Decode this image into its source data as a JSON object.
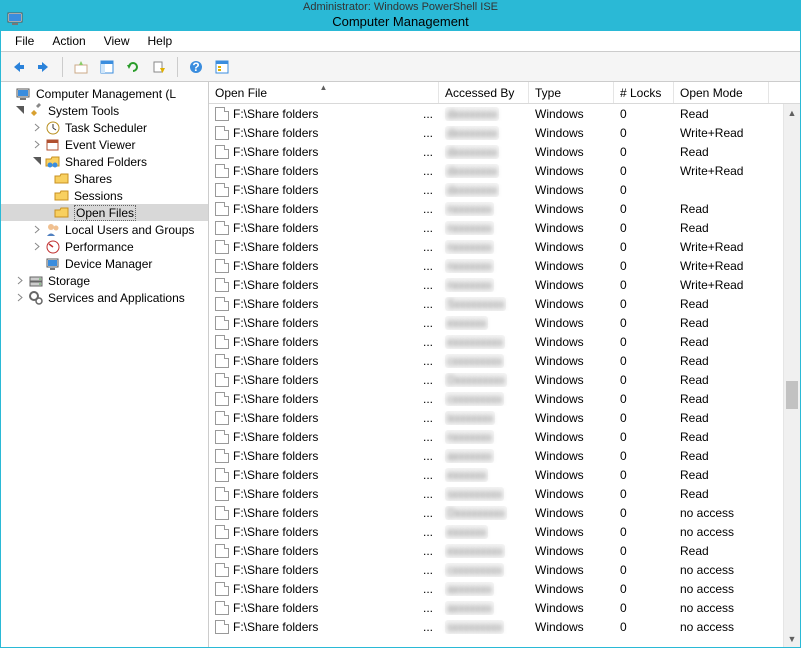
{
  "window": {
    "subtitle": "Administrator: Windows PowerShell ISE",
    "title": "Computer Management"
  },
  "menu": {
    "file": "File",
    "action": "Action",
    "view": "View",
    "help": "Help"
  },
  "tree": {
    "root": "Computer Management (L",
    "system_tools": "System Tools",
    "task_scheduler": "Task Scheduler",
    "event_viewer": "Event Viewer",
    "shared_folders": "Shared Folders",
    "shares": "Shares",
    "sessions": "Sessions",
    "open_files": "Open Files",
    "local_users": "Local Users and Groups",
    "performance": "Performance",
    "device_manager": "Device Manager",
    "storage": "Storage",
    "services_apps": "Services and Applications"
  },
  "columns": {
    "open_file": "Open File",
    "accessed_by": "Accessed By",
    "type": "Type",
    "locks": "# Locks",
    "open_mode": "Open Mode"
  },
  "col_widths": {
    "open_file": 230,
    "accessed_by": 90,
    "type": 85,
    "locks": 60,
    "open_mode": 95
  },
  "rows": [
    {
      "file": "F:\\Share folders",
      "user": "dxxxxxxxx",
      "type": "Windows",
      "locks": "0",
      "mode": "Read"
    },
    {
      "file": "F:\\Share folders",
      "user": "dxxxxxxxx",
      "type": "Windows",
      "locks": "0",
      "mode": "Write+Read"
    },
    {
      "file": "F:\\Share folders",
      "user": "dxxxxxxxx",
      "type": "Windows",
      "locks": "0",
      "mode": "Read"
    },
    {
      "file": "F:\\Share folders",
      "user": "dxxxxxxxx",
      "type": "Windows",
      "locks": "0",
      "mode": "Write+Read"
    },
    {
      "file": "F:\\Share folders",
      "user": "dxxxxxxxx",
      "type": "Windows",
      "locks": "0",
      "mode": ""
    },
    {
      "file": "F:\\Share folders",
      "user": "nxxxxxxx",
      "type": "Windows",
      "locks": "0",
      "mode": "Read"
    },
    {
      "file": "F:\\Share folders",
      "user": "nxxxxxxx",
      "type": "Windows",
      "locks": "0",
      "mode": "Read"
    },
    {
      "file": "F:\\Share folders",
      "user": "nxxxxxxx",
      "type": "Windows",
      "locks": "0",
      "mode": "Write+Read"
    },
    {
      "file": "F:\\Share folders",
      "user": "nxxxxxxx",
      "type": "Windows",
      "locks": "0",
      "mode": "Write+Read"
    },
    {
      "file": "F:\\Share folders",
      "user": "nxxxxxxx",
      "type": "Windows",
      "locks": "0",
      "mode": "Write+Read"
    },
    {
      "file": "F:\\Share folders",
      "user": "Sxxxxxxxxx",
      "type": "Windows",
      "locks": "0",
      "mode": "Read"
    },
    {
      "file": "F:\\Share folders",
      "user": "exxxxxx",
      "type": "Windows",
      "locks": "0",
      "mode": "Read"
    },
    {
      "file": "F:\\Share folders",
      "user": "exxxxxxxxx",
      "type": "Windows",
      "locks": "0",
      "mode": "Read"
    },
    {
      "file": "F:\\Share folders",
      "user": "cxxxxxxxxx",
      "type": "Windows",
      "locks": "0",
      "mode": "Read"
    },
    {
      "file": "F:\\Share folders",
      "user": "Dxxxxxxxxx",
      "type": "Windows",
      "locks": "0",
      "mode": "Read"
    },
    {
      "file": "F:\\Share folders",
      "user": "cxxxxxxxxx",
      "type": "Windows",
      "locks": "0",
      "mode": "Read"
    },
    {
      "file": "F:\\Share folders",
      "user": "ixxxxxxxx",
      "type": "Windows",
      "locks": "0",
      "mode": "Read"
    },
    {
      "file": "F:\\Share folders",
      "user": "nxxxxxxx",
      "type": "Windows",
      "locks": "0",
      "mode": "Read"
    },
    {
      "file": "F:\\Share folders",
      "user": "axxxxxxx",
      "type": "Windows",
      "locks": "0",
      "mode": "Read"
    },
    {
      "file": "F:\\Share folders",
      "user": "exxxxxx",
      "type": "Windows",
      "locks": "0",
      "mode": "Read"
    },
    {
      "file": "F:\\Share folders",
      "user": "sxxxxxxxxx",
      "type": "Windows",
      "locks": "0",
      "mode": "Read"
    },
    {
      "file": "F:\\Share folders",
      "user": "Dxxxxxxxxx",
      "type": "Windows",
      "locks": "0",
      "mode": "no access"
    },
    {
      "file": "F:\\Share folders",
      "user": "exxxxxx",
      "type": "Windows",
      "locks": "0",
      "mode": "no access"
    },
    {
      "file": "F:\\Share folders",
      "user": "exxxxxxxxx",
      "type": "Windows",
      "locks": "0",
      "mode": "Read"
    },
    {
      "file": "F:\\Share folders",
      "user": "cxxxxxxxxx",
      "type": "Windows",
      "locks": "0",
      "mode": "no access"
    },
    {
      "file": "F:\\Share folders",
      "user": "axxxxxxx",
      "type": "Windows",
      "locks": "0",
      "mode": "no access"
    },
    {
      "file": "F:\\Share folders",
      "user": "axxxxxxx",
      "type": "Windows",
      "locks": "0",
      "mode": "no access"
    },
    {
      "file": "F:\\Share folders",
      "user": "sxxxxxxxxx",
      "type": "Windows",
      "locks": "0",
      "mode": "no access"
    }
  ]
}
